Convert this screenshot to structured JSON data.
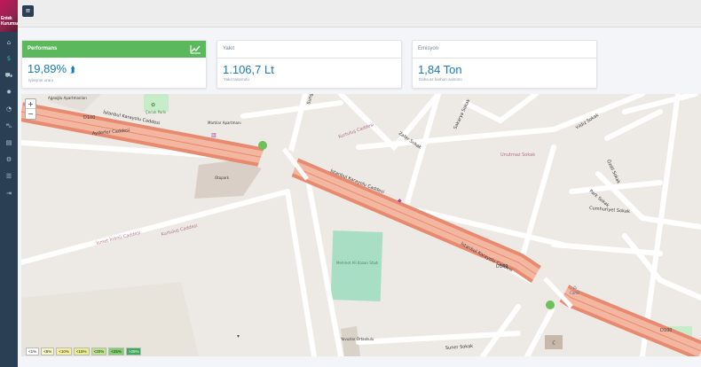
{
  "logo": {
    "text": "Entek Kurumsal"
  },
  "sidebar": {
    "items": [
      {
        "icon": "home-icon",
        "glyph": "⌂"
      },
      {
        "icon": "dollar-icon",
        "glyph": "$"
      },
      {
        "icon": "car-icon",
        "glyph": "⛟"
      },
      {
        "icon": "settings-icon",
        "glyph": "✹"
      },
      {
        "icon": "gauge-icon",
        "glyph": "◔"
      },
      {
        "icon": "truck-icon",
        "glyph": "⛍"
      },
      {
        "icon": "bar-chart-icon",
        "glyph": "▤"
      },
      {
        "icon": "cogs-icon",
        "glyph": "⚙"
      },
      {
        "icon": "list-icon",
        "glyph": "☰"
      },
      {
        "icon": "logout-icon",
        "glyph": "⇥"
      }
    ]
  },
  "topbar": {
    "menu_glyph": "≡"
  },
  "cards": [
    {
      "title": "Performans",
      "value": "19,89%",
      "value_icon": "⮭",
      "sub": "İyileşme oranı",
      "accent": "#5cb85c"
    },
    {
      "title": "Yakıt",
      "value": "1.106,7 Lt",
      "sub": "Yakıt tasarrufu"
    },
    {
      "title": "Emisyon",
      "value": "1,84 Ton",
      "sub": "Daha az karbon salınımı"
    }
  ],
  "map": {
    "zoom_in": "+",
    "zoom_out": "−",
    "labels": {
      "istanbul_1": "İstanbul Karayolu Caddesi",
      "istanbul_2": "İstanbul Karayolu Caddesi",
      "istanbul_3": "İstanbul Karayolu Caddesi",
      "ayderler": "Ayderler Caddesi",
      "d100_1": "D100",
      "d100_2": "D100",
      "d100_3": "D100",
      "ismet_inonu": "İsmet İnönü Caddesi",
      "cumhuriyet": "Cumhuriyet Sokak",
      "suner": "Suner Sokak",
      "sungur": "Sungur Sokak",
      "zafer": "Zafer Sokak",
      "sakarya": "Sakarya Sokak",
      "unutmaz": "Unutmaz Sokak",
      "yildiz": "Yıldız Sokak",
      "ozdil": "Özdil Sokak",
      "park": "Park Sokak",
      "otopark": "Otopark",
      "kurtulus_1": "Kurtuluş Caddesi",
      "kurtulus_2": "Kurtuluş Caddesi",
      "cocuk_parki": "Çocuk Parkı",
      "apartments": "Martılar Apartmanı",
      "apartmanlari": "Ağaoğlu Apartmanları",
      "camii": "Camii",
      "stadyum": "Mehmet Ali Kazan Stadı",
      "ortaokul": "Yavuzlar Ortaokulu"
    },
    "colors": {
      "route": "#e88a6f",
      "route_fill": "#f3b7a1",
      "field": "#a8dfc4",
      "park": "#c6ecc9"
    }
  },
  "legend": [
    {
      "label": "<1%",
      "color": "#ffffff"
    },
    {
      "label": "<5%",
      "color": "#f7f5c4"
    },
    {
      "label": "<10%",
      "color": "#f4ef9b"
    },
    {
      "label": "<15%",
      "color": "#e6f08c"
    },
    {
      "label": "<20%",
      "color": "#b9e389"
    },
    {
      "label": "<25%",
      "color": "#7fcf6e"
    },
    {
      "label": ">25%",
      "color": "#3fa85a"
    }
  ]
}
